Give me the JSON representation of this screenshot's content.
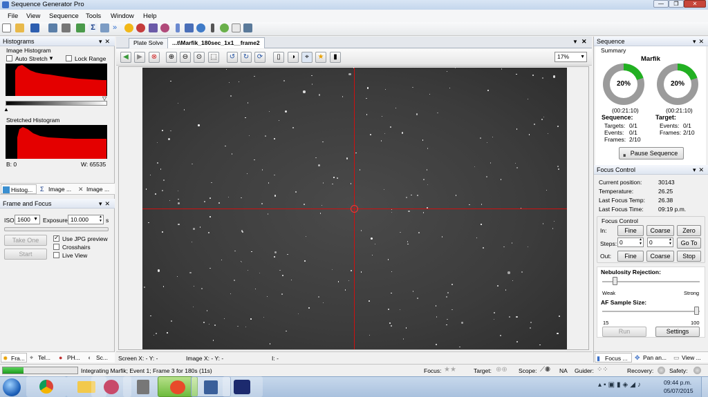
{
  "window": {
    "title": "Sequence Generator Pro"
  },
  "menu": [
    "File",
    "View",
    "Sequence",
    "Tools",
    "Window",
    "Help"
  ],
  "histograms": {
    "title": "Histograms",
    "image_hist_label": "Image Histogram",
    "auto_stretch": "Auto Stretch",
    "lock_range": "Lock Range",
    "stretched_label": "Stretched Histogram",
    "b_label": "B: 0",
    "w_label": "W: 65535"
  },
  "left_tabs_top": [
    "Histog...",
    "Image ...",
    "Image ..."
  ],
  "frame_focus": {
    "title": "Frame and Focus",
    "iso_label": "ISO",
    "iso_value": "1600",
    "exposure_label": "Exposure:",
    "exposure_value": "10.000",
    "exposure_unit": "s",
    "take_one": "Take One",
    "start": "Start",
    "use_jpg": "Use JPG preview",
    "crosshairs": "Crosshairs",
    "live_view": "Live View"
  },
  "left_tabs_bottom": [
    "Fra...",
    "Tel...",
    "PH...",
    "Sc..."
  ],
  "doc_tabs": [
    "Plate Solve",
    "...t\\Marfik_180sec_1x1__frame2"
  ],
  "zoom": "17%",
  "image_status": {
    "screen": "Screen X: - Y: -",
    "image": "Image X: - Y: -",
    "i": "I: -"
  },
  "sequence": {
    "title": "Sequence",
    "summary": "Summary",
    "target_name": "Marfik",
    "pct1": "20%",
    "pct2": "20%",
    "progress": 0.2,
    "time1": "(00:21:10)",
    "time2": "(00:21:10)",
    "seq_head": "Sequence:",
    "targets_l": "Targets:",
    "targets_v": "0/1",
    "events_l": "Events:",
    "events_v": "0/1",
    "frames_l": "Frames:",
    "frames_v": "2/10",
    "tgt_head": "Target:",
    "t_events_l": "Events:",
    "t_events_v": "0/1",
    "t_frames_l": "Frames:",
    "t_frames_v": "2/10",
    "pause_btn": "Pause Sequence"
  },
  "focus": {
    "title": "Focus Control",
    "cur_pos_l": "Current position:",
    "cur_pos_v": "30143",
    "temp_l": "Temperature:",
    "temp_v": "26.25",
    "last_temp_l": "Last Focus Temp:",
    "last_temp_v": "26.38",
    "last_time_l": "Last Focus Time:",
    "last_time_v": "09:19 p.m.",
    "group": "Focus Control",
    "in_l": "In:",
    "out_l": "Out:",
    "steps_l": "Steps:",
    "fine": "Fine",
    "coarse": "Coarse",
    "zero": "Zero",
    "goto": "Go To",
    "stop": "Stop",
    "steps1": "0",
    "steps2": "0",
    "neb_title": "Nebulosity Rejection:",
    "weak": "Weak",
    "strong": "Strong",
    "af_title": "AF Sample Size:",
    "af_min": "15",
    "af_max": "100",
    "run": "Run",
    "settings": "Settings"
  },
  "right_tabs_bottom": [
    "Focus ...",
    "Pan an...",
    "View ..."
  ],
  "status": {
    "progress": 0.28,
    "text": "Integrating Marfik; Event 1; Frame 3 for 180s (11s)",
    "focus": "Focus:",
    "target": "Target:",
    "scope": "Scope:",
    "scope_v": "NA",
    "guider": "Guider:",
    "recovery": "Recovery:",
    "safety": "Safety:"
  },
  "clock": {
    "time": "09:44 p.m.",
    "date": "05/07/2015"
  }
}
